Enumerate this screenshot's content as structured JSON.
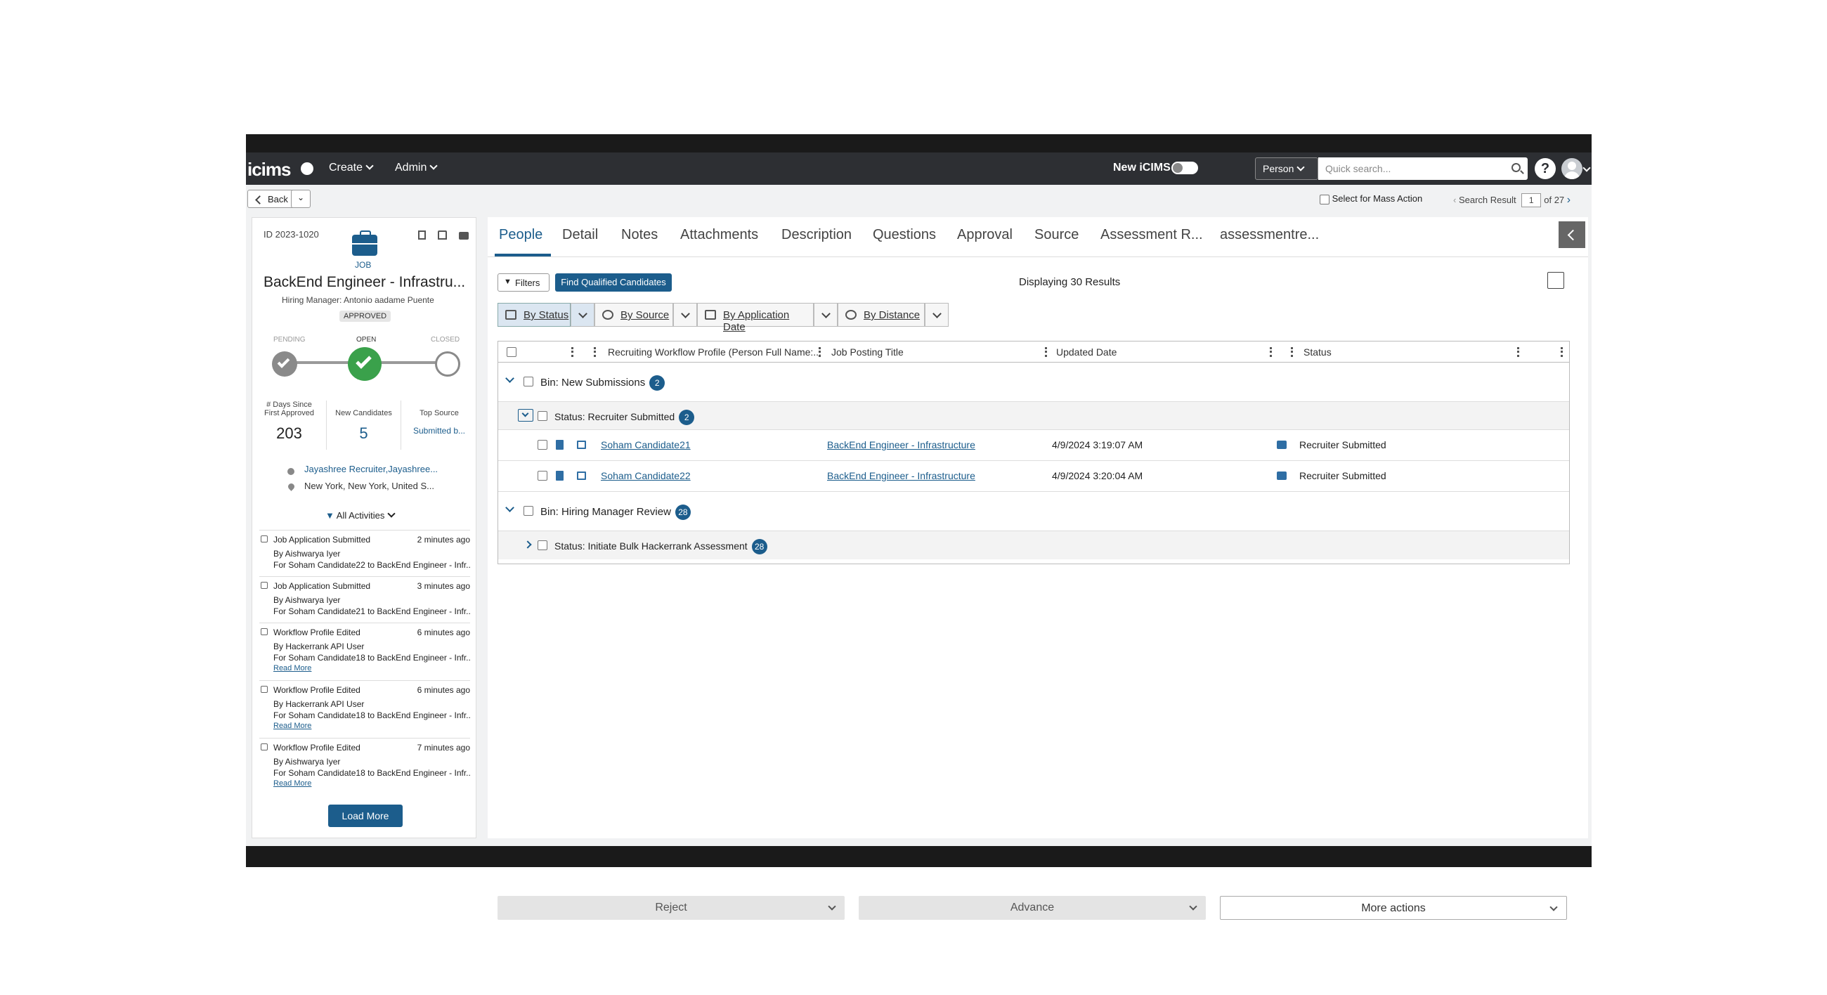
{
  "nav": {
    "logo": "icims",
    "create": "Create",
    "admin": "Admin",
    "new_icims": "New iCIMS",
    "person_select": "Person",
    "search_placeholder": "Quick search...",
    "help": "?"
  },
  "subbar": {
    "back": "Back",
    "mass_action": "Select for Mass Action",
    "search_result_label": "Search Result",
    "page": "1",
    "of_total": "of 27"
  },
  "job": {
    "id": "ID 2023-1020",
    "type": "JOB",
    "title": "BackEnd Engineer - Infrastru...",
    "hiring_manager": "Hiring Manager: Antonio aadame Puente",
    "status_badge": "APPROVED",
    "stages": [
      "PENDING",
      "OPEN",
      "CLOSED"
    ],
    "stats": [
      {
        "label1": "# Days Since",
        "label2": "First Approved",
        "value": "203"
      },
      {
        "label1": "New Candidates",
        "label2": "",
        "value": "5"
      },
      {
        "label1": "Top Source",
        "label2": "",
        "value": "Submitted b..."
      }
    ],
    "recruiter": "Jayashree Recruiter,Jayashree...",
    "location": "New York, New York, United S...",
    "activities_filter": "All Activities",
    "activities": [
      {
        "title": "Job Application Submitted",
        "time": "2 minutes ago",
        "by": "By Aishwarya Iyer",
        "for": "For Soham Candidate22 to BackEnd Engineer - Infr...",
        "more": ""
      },
      {
        "title": "Job Application Submitted",
        "time": "3 minutes ago",
        "by": "By Aishwarya Iyer",
        "for": "For Soham Candidate21 to BackEnd Engineer - Infr...",
        "more": ""
      },
      {
        "title": "Workflow Profile Edited",
        "time": "6 minutes ago",
        "by": "By Hackerrank API User",
        "for": "For Soham Candidate18 to BackEnd Engineer - Infr...",
        "more": "Read More"
      },
      {
        "title": "Workflow Profile Edited",
        "time": "6 minutes ago",
        "by": "By Hackerrank API User",
        "for": "For Soham Candidate18 to BackEnd Engineer - Infr...",
        "more": "Read More"
      },
      {
        "title": "Workflow Profile Edited",
        "time": "7 minutes ago",
        "by": "By Aishwarya Iyer",
        "for": "For Soham Candidate18 to BackEnd Engineer - Infr...",
        "more": "Read More"
      }
    ],
    "load_more": "Load More"
  },
  "tabs": [
    "People",
    "Detail",
    "Notes",
    "Attachments",
    "Description",
    "Questions",
    "Approval",
    "Source",
    "Assessment R...",
    "assessmentre..."
  ],
  "toolbar": {
    "filters": "Filters",
    "find_qualified": "Find Qualified Candidates",
    "displaying": "Displaying 30 Results",
    "group_by": [
      "By Status",
      "By Source",
      "By Application Date",
      "By Distance"
    ]
  },
  "grid": {
    "columns": [
      "Recruiting Workflow Profile (Person Full Name:...",
      "Job Posting Title",
      "Updated Date",
      "Status"
    ],
    "bins": [
      {
        "label": "Bin: New Submissions",
        "count": "2",
        "status_label": "Status: Recruiter Submitted",
        "status_count": "2"
      },
      {
        "label": "Bin: Hiring Manager Review",
        "count": "28",
        "status_label": "Status: Initiate Bulk Hackerrank Assessment",
        "status_count": "28"
      }
    ],
    "rows": [
      {
        "name": "Soham Candidate21",
        "job": "BackEnd Engineer - Infrastructure",
        "updated": "4/9/2024 3:19:07 AM",
        "status": "Recruiter Submitted"
      },
      {
        "name": "Soham Candidate22",
        "job": "BackEnd Engineer - Infrastructure",
        "updated": "4/9/2024 3:20:04 AM",
        "status": "Recruiter Submitted"
      }
    ]
  },
  "actions": {
    "reject": "Reject",
    "advance": "Advance",
    "more": "More actions"
  },
  "colors": {
    "accent": "#1c5d8c",
    "open_green": "#3aa14b",
    "nav_bg": "#2d2f33"
  }
}
